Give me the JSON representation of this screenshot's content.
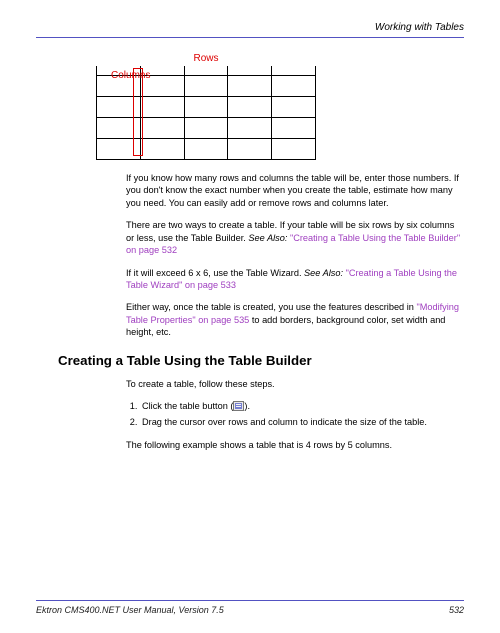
{
  "header": {
    "chapter": "Working with Tables"
  },
  "diagram": {
    "rows_label": "Rows",
    "cols_label": "Columns"
  },
  "paragraphs": {
    "p1": "If you know how many rows and columns the table will be, enter those numbers. If you don't know the exact number when you create the table, estimate how many you need. You can easily add or remove rows and columns later.",
    "p2_lead": "There are two ways to create a table. If your table will be six rows by six columns or less, use the Table Builder. ",
    "p2_seealso_label": "See Also: ",
    "p2_link": "\"Creating a Table Using the Table Builder\" on page 532",
    "p3_lead": "If it will exceed 6 x 6, use the Table Wizard. ",
    "p3_seealso_label": "See Also: ",
    "p3_link": "\"Creating a Table Using the Table Wizard\" on page 533",
    "p4_lead": "Either way, once the table is created, you use the features described in ",
    "p4_link": "\"Modifying Table Properties\" on page 535",
    "p4_tail": " to add borders, background color, set width and height, etc."
  },
  "section_heading": "Creating a Table Using the Table Builder",
  "intro_line": "To create a table, follow these steps.",
  "steps": {
    "s1_a": "Click the table button (",
    "s1_b": ").",
    "s2": "Drag the cursor over rows and column to indicate the size of the table."
  },
  "followup": "The following example shows a table that is 4 rows by 5 columns.",
  "footer": {
    "manual": "Ektron CMS400.NET User Manual, Version 7.5",
    "page": "532"
  }
}
